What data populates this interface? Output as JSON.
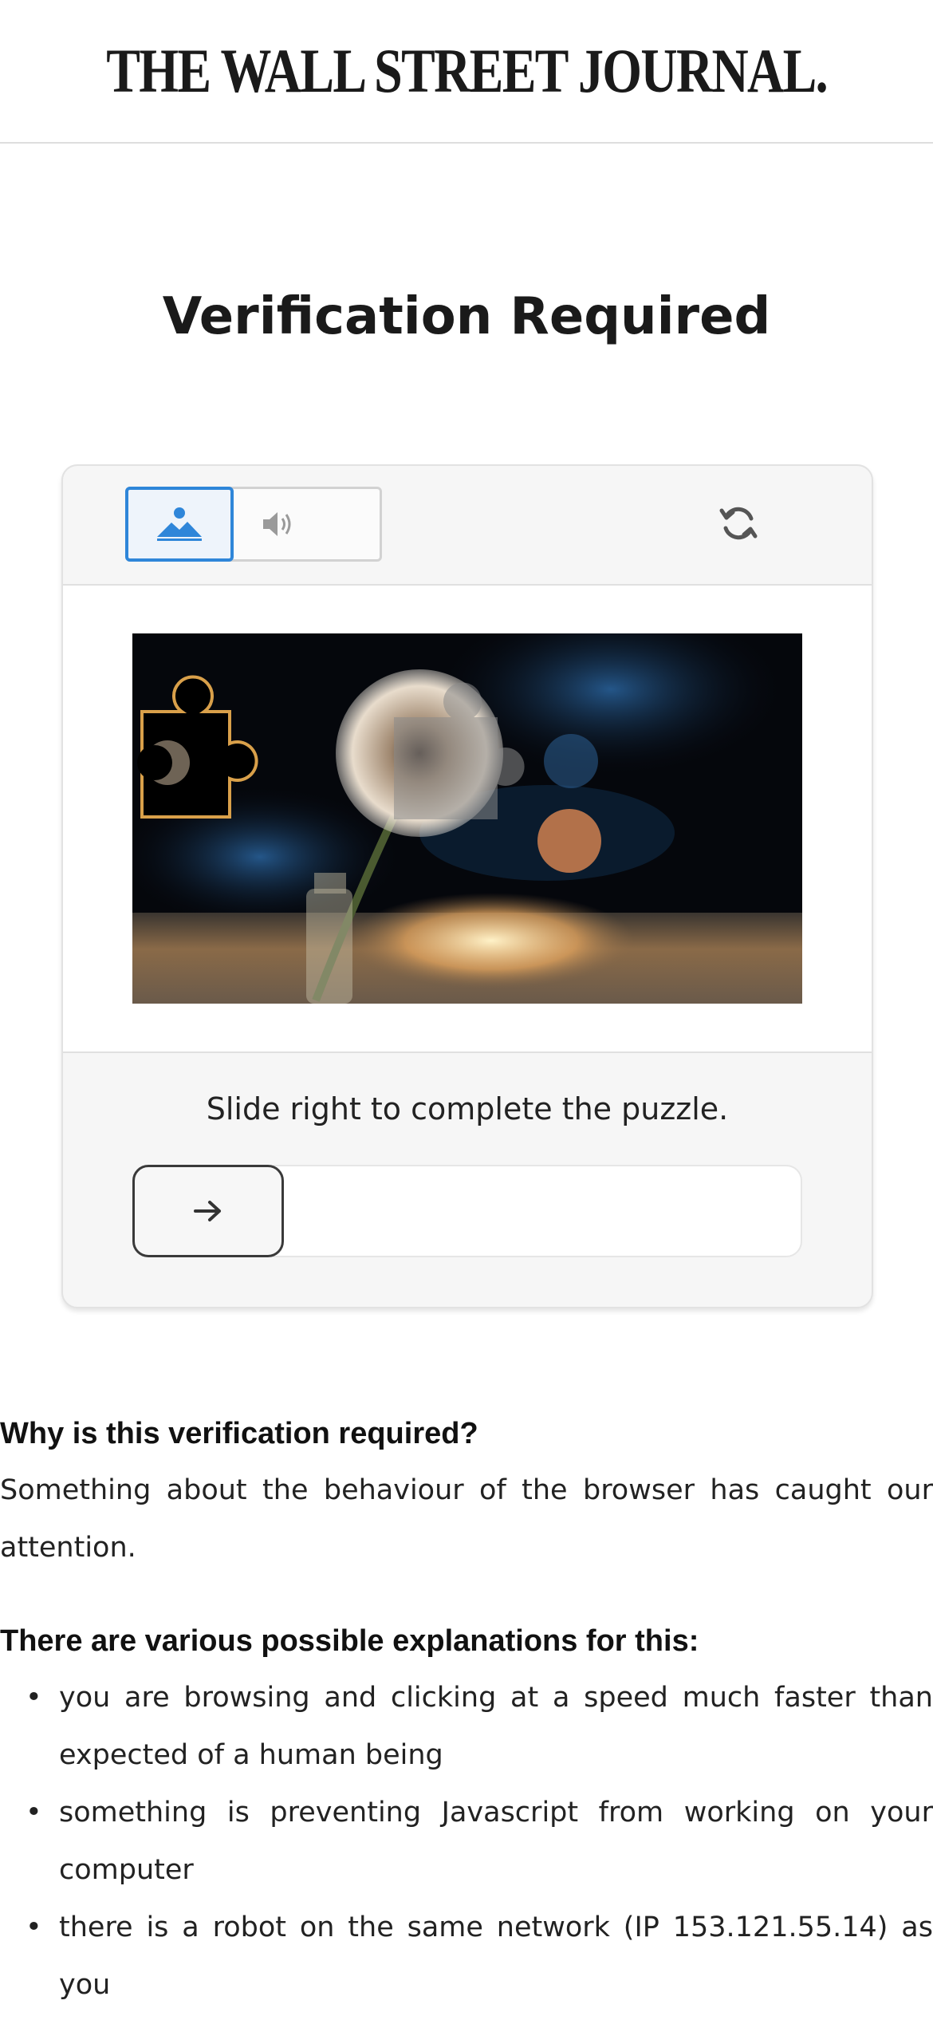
{
  "header": {
    "masthead": "THE WALL STREET JOURNAL."
  },
  "page": {
    "title": "Verification Required"
  },
  "captcha": {
    "modes": {
      "image_icon": "image-icon",
      "audio_icon": "speaker-icon",
      "selected": "image"
    },
    "refresh_icon": "refresh-icon",
    "instruction": "Slide right to complete the puzzle.",
    "slider_icon": "arrow-right-icon",
    "slider_progress": 0,
    "accent_color": "#2f86d9",
    "puzzle_piece_color": "#d9a04a"
  },
  "info": {
    "why_heading": "Why is this verification required?",
    "why_text": "Something about the behaviour of the browser has caught our attention.",
    "explanations_heading": "There are various possible explanations for this:",
    "explanations": [
      "you are browsing and clicking at a speed much faster than expected of a human being",
      "something is preventing Javascript from working on your computer",
      "there is a robot on the same network (IP 153.121.55.14) as you"
    ]
  }
}
